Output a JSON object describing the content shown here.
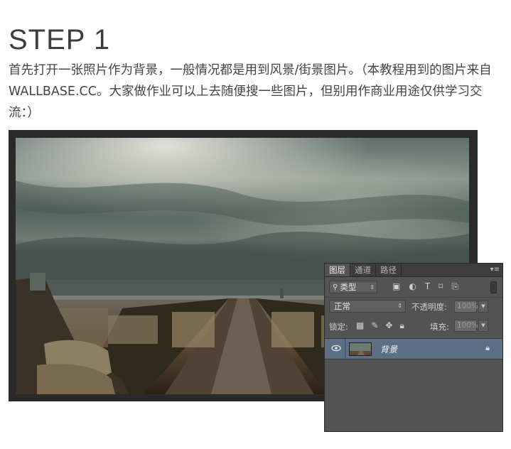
{
  "heading": "STEP 1",
  "intro": "首先打开一张照片作为背景，一般情况都是用到风景/街景图片。（本教程用到的图片来自WALLBASE.CC。大家做作业可以上去随便搜一些图片，但别用作商业用途仅供学习交流：）",
  "layers_panel": {
    "tabs": [
      "图层",
      "通道",
      "路径"
    ],
    "active_tab": "图层",
    "filter": {
      "label": "类型",
      "icon": "search-icon"
    },
    "filter_icons": [
      "image-filter-icon",
      "adjustment-filter-icon",
      "type-filter-icon",
      "shape-filter-icon",
      "smart-object-filter-icon"
    ],
    "blend_mode": "正常",
    "opacity_label": "不透明度:",
    "opacity_value": "100%",
    "lock_label": "锁定:",
    "lock_icons": [
      "lock-transparent-icon",
      "lock-image-icon",
      "lock-position-icon",
      "lock-all-icon"
    ],
    "fill_label": "填充:",
    "fill_value": "100%",
    "layers": [
      {
        "name": "背景",
        "visible": true,
        "locked": true,
        "selected": true
      }
    ],
    "colors": {
      "panel_bg": "#535353",
      "selected_layer": "#5d6e87",
      "tab_bar": "#3d3d3d"
    }
  }
}
